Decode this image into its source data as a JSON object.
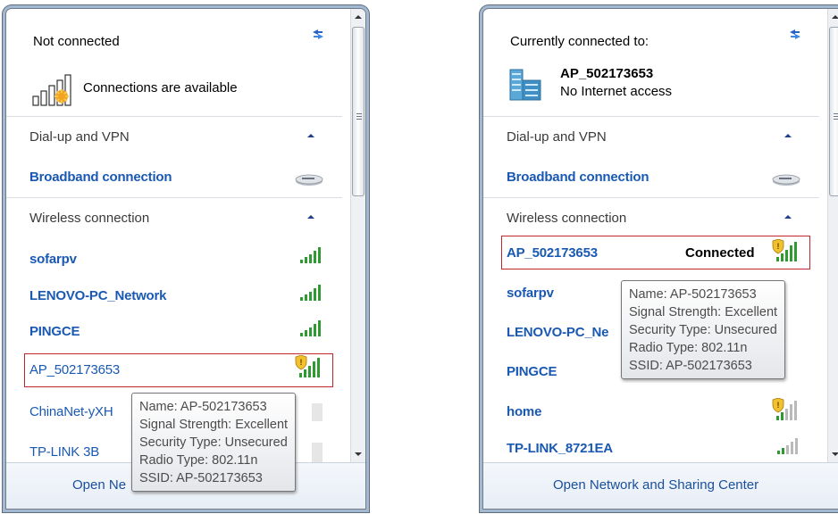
{
  "left": {
    "status": "Not connected",
    "availability": "Connections are available",
    "sections": {
      "dialup": "Dial-up and VPN",
      "wireless": "Wireless connection"
    },
    "broadband": "Broadband connection",
    "networks": [
      "sofarpv",
      "LENOVO-PC_Network",
      "PINGCE",
      "AP_502173653",
      "ChinaNet-yXH",
      "TP-LINK 3B"
    ],
    "footer_link": "Open Ne",
    "tooltip": [
      "Name: AP-502173653",
      "Signal Strength: Excellent",
      "Security Type: Unsecured",
      "Radio Type: 802.11n",
      "SSID: AP-502173653"
    ]
  },
  "right": {
    "status": "Currently connected to:",
    "ap_name": "AP_502173653",
    "internet": "No Internet access",
    "sections": {
      "dialup": "Dial-up and VPN",
      "wireless": "Wireless connection"
    },
    "broadband": "Broadband connection",
    "connected_network": "AP_502173653",
    "connected_label": "Connected",
    "networks": [
      "sofarpv",
      "LENOVO-PC_Ne",
      "PINGCE",
      "home",
      "TP-LINK_8721EA"
    ],
    "footer_link": "Open Network and Sharing Center",
    "tooltip": [
      "Name: AP-502173653",
      "Signal Strength: Excellent",
      "Security Type: Unsecured",
      "Radio Type: 802.11n",
      "SSID: AP-502173653"
    ]
  },
  "colors": {
    "link": "#1a59b3",
    "highlight_border": "#c0272d",
    "signal_green": "#2f9a2f",
    "signal_gray": "#b9b9b9",
    "shield_yellow": "#f2c12e"
  }
}
